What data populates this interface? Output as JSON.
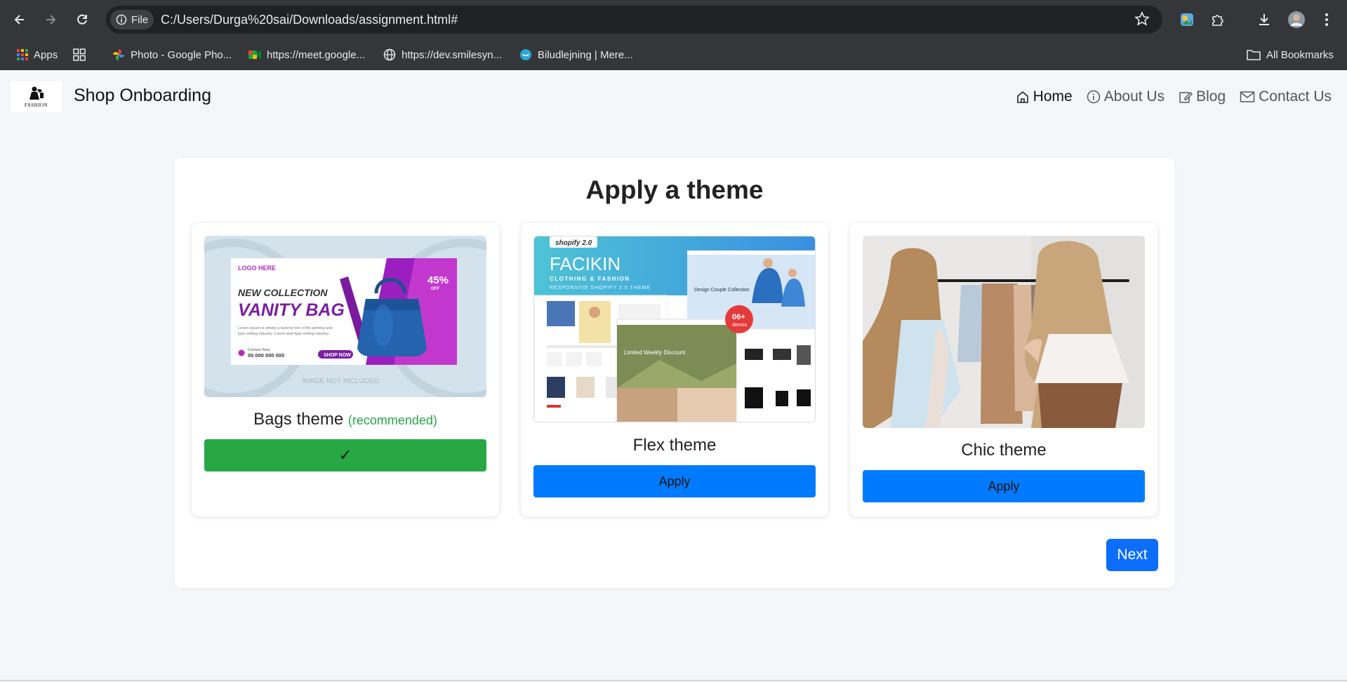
{
  "browser": {
    "site_info_label": "File",
    "url": "C:/Users/Durga%20sai/Downloads/assignment.html#",
    "bookmarks": [
      {
        "label": "Apps",
        "icon": "apps-grid-icon"
      },
      {
        "label": "",
        "icon": "tab-groups-icon"
      },
      {
        "label": "Photo - Google Pho...",
        "icon": "google-photos-icon"
      },
      {
        "label": "https://meet.google...",
        "icon": "google-meet-icon"
      },
      {
        "label": "https://dev.smilesyn...",
        "icon": "globe-icon"
      },
      {
        "label": "Biludlejning | Mere...",
        "icon": "site-icon"
      }
    ],
    "all_bookmarks_label": "All Bookmarks"
  },
  "header": {
    "logo_text": "FASHION",
    "brand": "Shop Onboarding",
    "nav": [
      {
        "label": "Home",
        "icon": "home-icon",
        "active": true
      },
      {
        "label": "About Us",
        "icon": "info-icon",
        "active": false
      },
      {
        "label": "Blog",
        "icon": "edit-icon",
        "active": false
      },
      {
        "label": "Contact Us",
        "icon": "envelope-icon",
        "active": false
      }
    ]
  },
  "main": {
    "title": "Apply a theme",
    "themes": [
      {
        "name": "Bags theme",
        "badge": "(recommended)",
        "button_label": "✓",
        "image": {
          "logo": "LOGO HERE",
          "line1": "NEW COLLECTION",
          "line2": "VANITY BAG",
          "discount": "45%",
          "discount_sub": "OFF",
          "body": "Lorem ipsum is simply a dummy text of the printing and type setting industry. Lorem land type setting industry.",
          "contact_label": "Contact Now:",
          "contact": "00 000 000 000",
          "shop": "SHOP NOW",
          "footer": "IMAGE NOT INCLUDED"
        }
      },
      {
        "name": "Flex theme",
        "button_label": "Apply",
        "image": {
          "badge": "shopify 2.0",
          "brand": "FACIKIN",
          "tag1": "CLOTHING & FASHION",
          "tag2": "RESPONSIVE SHOPIFY 2.0 THEME",
          "demos": "06+",
          "demos_sub": "demos",
          "card1": "Design Couple Collection",
          "card2": "Limited Weekly Discount"
        }
      },
      {
        "name": "Chic theme",
        "button_label": "Apply"
      }
    ],
    "next_label": "Next"
  },
  "colors": {
    "accent_blue": "#007bff",
    "success_green": "#28a745",
    "next_blue": "#0d6efd",
    "chrome_bg": "#35363a"
  }
}
